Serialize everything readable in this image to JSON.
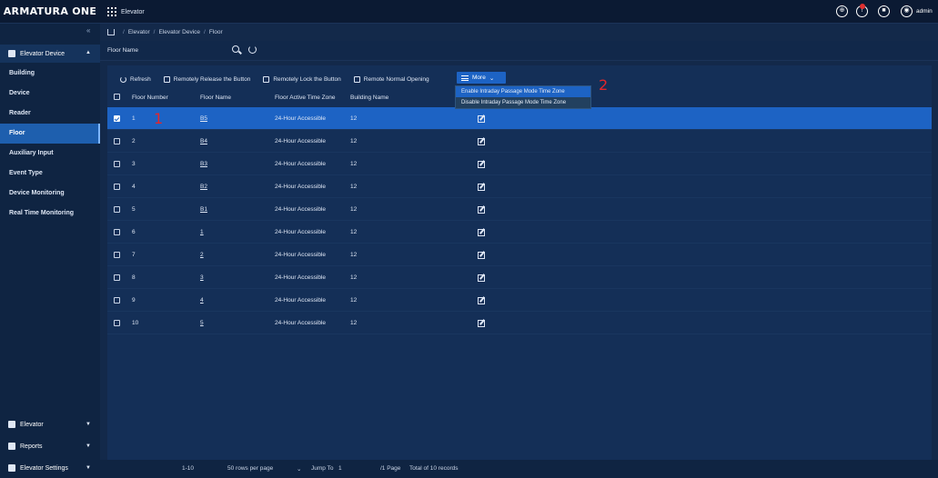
{
  "app": {
    "title": "ARMATURA ONE",
    "module": "Elevator",
    "user": "admin"
  },
  "breadcrumb": [
    "Elevator",
    "Elevator Device",
    "Floor"
  ],
  "sidebar": {
    "group_top": "Elevator Device",
    "items": [
      {
        "label": "Building"
      },
      {
        "label": "Device"
      },
      {
        "label": "Reader"
      },
      {
        "label": "Floor"
      },
      {
        "label": "Auxiliary Input"
      },
      {
        "label": "Event Type"
      },
      {
        "label": "Device Monitoring"
      },
      {
        "label": "Real Time Monitoring"
      }
    ],
    "groups_bottom": [
      {
        "label": "Elevator"
      },
      {
        "label": "Reports"
      },
      {
        "label": "Elevator Settings"
      }
    ]
  },
  "filter": {
    "label": "Floor Name"
  },
  "toolbar": {
    "refresh": "Refresh",
    "release": "Remotely Release the Button",
    "lock": "Remotely Lock the Button",
    "normal": "Remote Normal Opening",
    "more": "More"
  },
  "dropdown": [
    "Enable Intraday Passage Mode Time Zone",
    "Disable Intraday Passage Mode Time Zone"
  ],
  "annotations": {
    "a1": "1",
    "a2": "2"
  },
  "table": {
    "headers": {
      "floor_number": "Floor Number",
      "floor_name": "Floor Name",
      "time_zone": "Floor Active Time Zone",
      "building": "Building Name"
    },
    "rows": [
      {
        "num": "1",
        "name": "B5",
        "tz": "24-Hour Accessible",
        "bld": "12",
        "checked": true
      },
      {
        "num": "2",
        "name": "B4",
        "tz": "24-Hour Accessible",
        "bld": "12"
      },
      {
        "num": "3",
        "name": "B3",
        "tz": "24-Hour Accessible",
        "bld": "12"
      },
      {
        "num": "4",
        "name": "B2",
        "tz": "24-Hour Accessible",
        "bld": "12"
      },
      {
        "num": "5",
        "name": "B1",
        "tz": "24-Hour Accessible",
        "bld": "12"
      },
      {
        "num": "6",
        "name": "1",
        "tz": "24-Hour Accessible",
        "bld": "12"
      },
      {
        "num": "7",
        "name": "2",
        "tz": "24-Hour Accessible",
        "bld": "12"
      },
      {
        "num": "8",
        "name": "3",
        "tz": "24-Hour Accessible",
        "bld": "12"
      },
      {
        "num": "9",
        "name": "4",
        "tz": "24-Hour Accessible",
        "bld": "12"
      },
      {
        "num": "10",
        "name": "5",
        "tz": "24-Hour Accessible",
        "bld": "12"
      }
    ]
  },
  "pager": {
    "range": "1-10",
    "per_page": "50 rows per page",
    "jump": "Jump To",
    "page": "1",
    "pages": "/1 Page",
    "total": "Total of 10 records"
  }
}
